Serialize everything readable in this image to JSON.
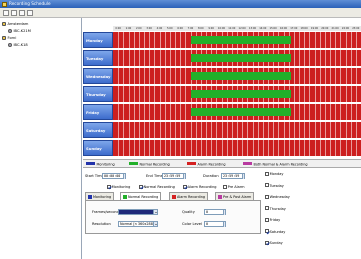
{
  "window": {
    "title": "Recording Schedule"
  },
  "colors": {
    "monitoring": "#2233aa",
    "normal": "#22b02a",
    "alarm": "#d42121",
    "both": "#b83aa0"
  },
  "tree": [
    {
      "label": "Amsterdam",
      "icon": "site-icon",
      "indent": 0
    },
    {
      "label": "IBC-K21M",
      "icon": "camera-icon",
      "indent": 1
    },
    {
      "label": "Forni",
      "icon": "site-icon",
      "indent": 0
    },
    {
      "label": "IBC-K18",
      "icon": "camera-icon",
      "indent": 1
    }
  ],
  "hours": [
    "0:00",
    "1:00",
    "2:00",
    "3:00",
    "4:00",
    "5:00",
    "6:00",
    "7:00",
    "8:00",
    "9:00",
    "10:00",
    "11:00",
    "12:00",
    "13:00",
    "14:00",
    "15:00",
    "16:00",
    "17:00",
    "18:00",
    "19:00",
    "20:00",
    "21:00",
    "22:00",
    "23:00"
  ],
  "days": [
    {
      "label": "Monday",
      "green": [
        [
          7.5,
          17.2
        ]
      ]
    },
    {
      "label": "Tuesday",
      "green": [
        [
          7.5,
          17.2
        ]
      ]
    },
    {
      "label": "Wednesday",
      "green": [
        [
          7.5,
          17.2
        ]
      ]
    },
    {
      "label": "Thursday",
      "green": [
        [
          7.5,
          17.2
        ]
      ]
    },
    {
      "label": "Friday",
      "green": [
        [
          7.5,
          17.2
        ]
      ]
    },
    {
      "label": "Saturday",
      "green": []
    },
    {
      "label": "Sunday",
      "green": []
    }
  ],
  "legend": [
    "Monitoring",
    "Normal Recording",
    "Alarm Recording",
    "Both Normal & Alarm Recording"
  ],
  "panel": {
    "start_time_label": "Start Time",
    "start_time": "00:00:00",
    "end_time_label": "End Time",
    "end_time": "23:59:59",
    "duration_label": "Duration",
    "duration": "23:59:59",
    "checks": [
      {
        "label": "Monitoring",
        "checked": true
      },
      {
        "label": "Normal Recording",
        "checked": true
      },
      {
        "label": "Alarm Recording",
        "checked": true
      },
      {
        "label": "Pre Alarm",
        "checked": false
      }
    ],
    "tabs": [
      "Monitoring",
      "Normal Recording",
      "Alarm Recording",
      "Pre & Post Alarm"
    ],
    "frames_label": "Frames/second",
    "frames_value": "",
    "resolution_label": "Resolution",
    "resolution_value": "Normal [n 360x288]",
    "quality_label": "Quality",
    "quality_value": "0",
    "color_label": "Color Level",
    "color_value": "0",
    "weekdays": [
      {
        "label": "Monday",
        "checked": false
      },
      {
        "label": "Tuesday",
        "checked": false
      },
      {
        "label": "Wednesday",
        "checked": false
      },
      {
        "label": "Thursday",
        "checked": false
      },
      {
        "label": "Friday",
        "checked": false
      },
      {
        "label": "Saturday",
        "checked": true
      },
      {
        "label": "Sunday",
        "checked": true
      }
    ]
  }
}
